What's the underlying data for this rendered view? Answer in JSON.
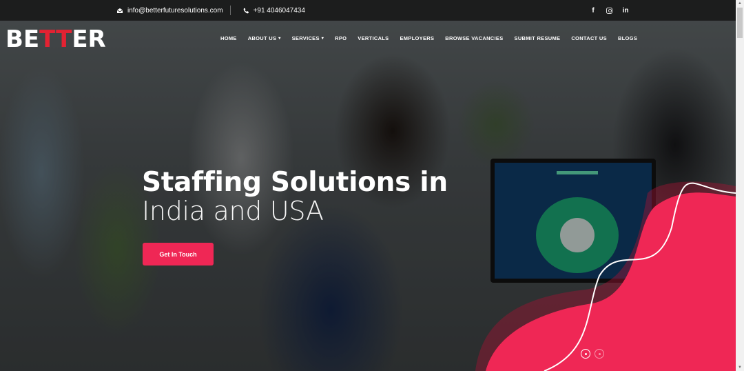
{
  "topbar": {
    "email": "info@betterfuturesolutions.com",
    "phone": "+91 4046047434",
    "email_icon": "envelope-icon",
    "phone_icon": "phone-icon",
    "social": [
      {
        "name": "facebook",
        "glyph": "f"
      },
      {
        "name": "instagram",
        "glyph": ""
      },
      {
        "name": "linkedin",
        "glyph": "in"
      }
    ]
  },
  "logo": {
    "prefix": "BE",
    "accent": "TT",
    "suffix": "ER"
  },
  "nav": {
    "items": [
      {
        "label": "HOME",
        "dropdown": false
      },
      {
        "label": "ABOUT US",
        "dropdown": true
      },
      {
        "label": "SERVICES",
        "dropdown": true
      },
      {
        "label": "RPO",
        "dropdown": false
      },
      {
        "label": "VERTICALS",
        "dropdown": false
      },
      {
        "label": "EMPLOYERS",
        "dropdown": false
      },
      {
        "label": "BROWSE VACANCIES",
        "dropdown": false
      },
      {
        "label": "SUBMIT RESUME",
        "dropdown": false
      },
      {
        "label": "CONTACT US",
        "dropdown": false
      },
      {
        "label": "BLOGS",
        "dropdown": false
      }
    ],
    "chevron": "▾"
  },
  "hero": {
    "headline_bold": "Staffing Solutions in",
    "headline_light": "India and USA",
    "cta_label": "Get In Touch",
    "slides": 2,
    "active_slide": 1
  },
  "colors": {
    "accent": "#ef2755",
    "topbar_bg": "#1c1d1d",
    "logo_accent": "#e32232"
  }
}
